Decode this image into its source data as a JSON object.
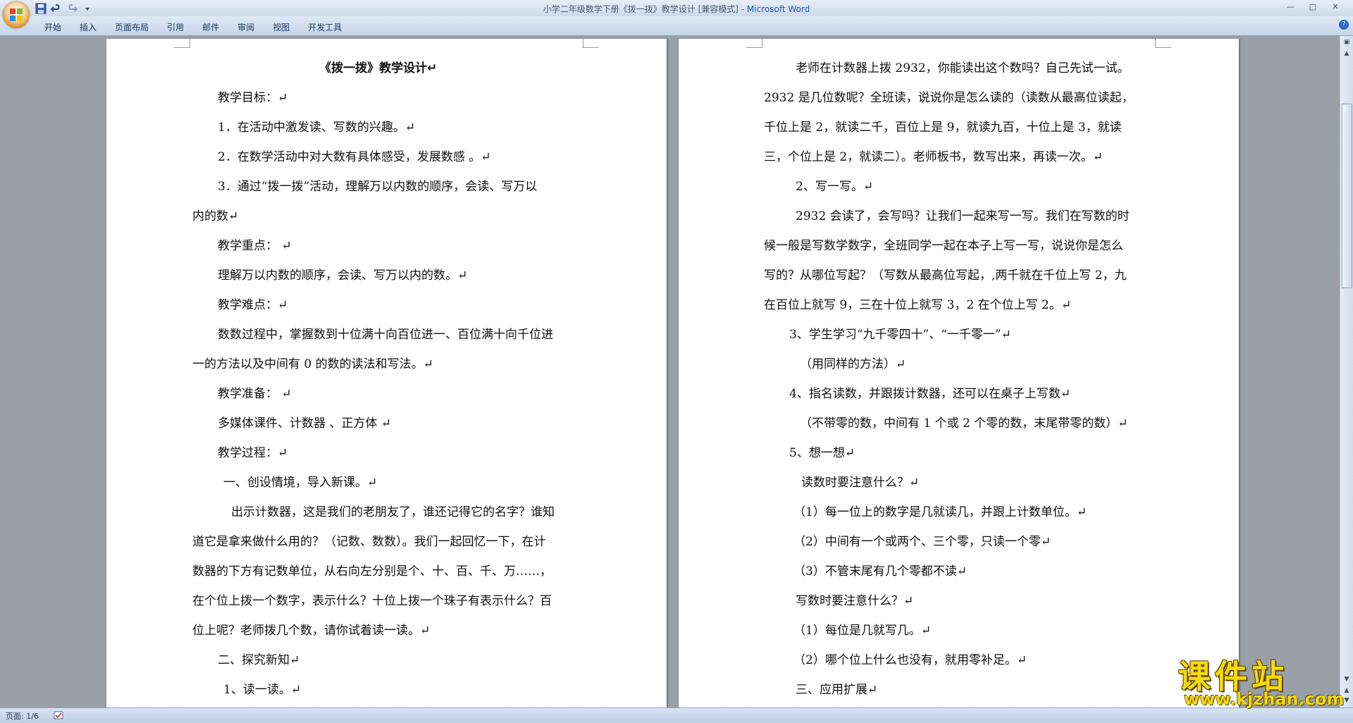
{
  "titlebar": {
    "doc_title": "小学二年级数学下册《拨一拨》教学设计 [兼容模式] - ",
    "app_name": "Microsoft Word",
    "qat_icons": [
      "save-icon",
      "undo-icon",
      "redo-icon",
      "customize-icon"
    ]
  },
  "ribbon": {
    "tabs": [
      "开始",
      "插入",
      "页面布局",
      "引用",
      "邮件",
      "审阅",
      "视图",
      "开发工具"
    ]
  },
  "statusbar": {
    "page_info": "页面: 1/6"
  },
  "watermark": {
    "brand": "课件站",
    "url": "www.kjzhan.com"
  },
  "left_page": {
    "lines": [
      "《拨一拨》教学设计↵",
      "教学目标：↵",
      "1．在活动中激发读、写数的兴趣。↵",
      "2．在数学活动中对大数有具体感受，发展数感 。↵",
      "3．通过“拨一拨”活动，理解万以内数的顺序，会读、写万以",
      "内的数↵",
      "教学重点： ↵",
      "理解万以内数的顺序，会读、写万以内的数。↵",
      "教学难点：↵",
      "数数过程中，掌握数到十位满十向百位进一、百位满十向千位进",
      "一的方法以及中间有 0 的数的读法和写法。↵",
      "教学准备： ↵",
      "多媒体课件、计数器 、正方体 ↵",
      "教学过程：↵",
      "一、创设情境，导入新课。↵",
      "出示计数器，这是我们的老朋友了，谁还记得它的名字？谁知",
      "道它是拿来做什么用的？（记数、数数）。我们一起回忆一下，在计",
      "数器的下方有记数单位，从右向左分别是个、十、百、千、万……，",
      "在个位上拨一个数字，表示什么？十位上拨一个珠子有表示什么？百",
      "位上呢？老师拨几个数，请你试着读一读。↵",
      "二、探究新知↵",
      "1、读一读。↵"
    ]
  },
  "right_page": {
    "lines": [
      "老师在计数器上拨 2932，你能读出这个数吗？自己先试一试。",
      "2932 是几位数呢？全班读，说说你是怎么读的（读数从最高位读起，",
      "千位上是 2，就读二千，百位上是 9，就读九百，十位上是 3，就读",
      "三，个位上是 2，就读二）。老师板书，数写出来，再读一次。↵",
      "2、写一写。↵",
      "2932 会读了，会写吗？让我们一起来写一写。我们在写数的时",
      "候一般是写数学数字，全班同学一起在本子上写一写，说说你是怎么",
      "写的？从哪位写起？（写数从最高位写起，,两千就在千位上写 2，九",
      "在百位上就写 9，三在十位上就写 3，2 在个位上写 2。↵",
      "3、学生学习“九千零四十”、“一千零一”↵",
      "（用同样的方法）↵",
      "4、指名读数，并跟拨计数器，还可以在桌子上写数↵",
      "（不带零的数，中间有 1 个或 2 个零的数，末尾带零的数）↵",
      "5、想一想↵",
      "读数时要注意什么？↵",
      "（1）每一位上的数字是几就读几，并跟上计数单位。↵",
      "（2）中间有一个或两个、三个零，只读一个零↵",
      "（3）不管末尾有几个零都不读↵",
      "写数时要注意什么？↵",
      "（1）每位是几就写几。↵",
      "（2）哪个位上什么也没有，就用零补足。↵",
      "三、应用扩展↵"
    ]
  }
}
